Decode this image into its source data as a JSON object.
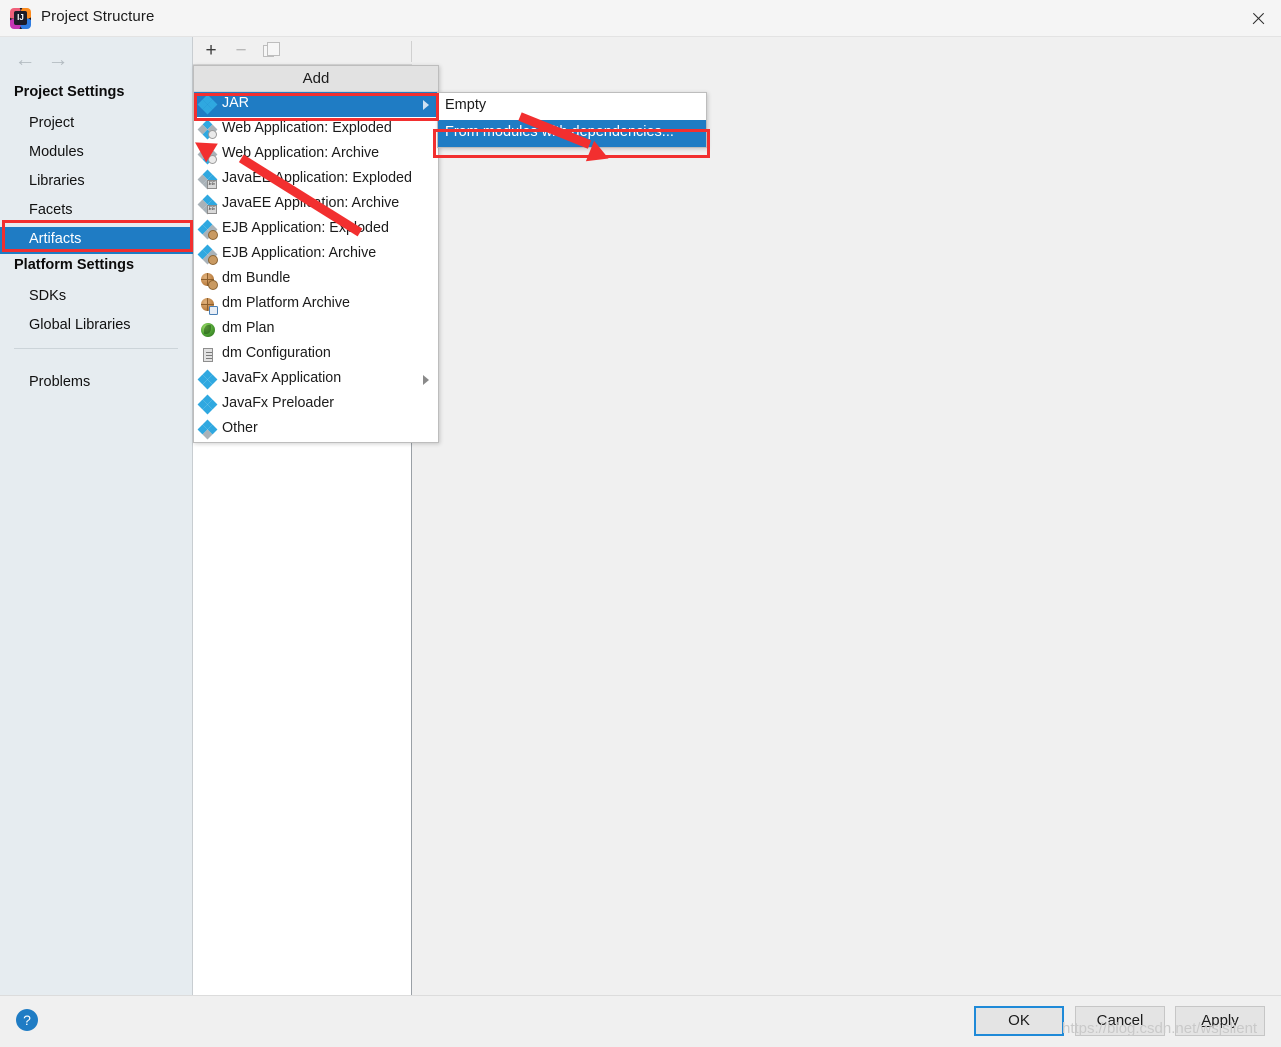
{
  "window": {
    "title": "Project Structure",
    "app_icon": "intellij-idea-icon",
    "icon_text": "IJ",
    "close_icon": "close-icon"
  },
  "nav": {
    "back_icon": "←",
    "forward_icon": "→"
  },
  "sidebar": {
    "sections": [
      {
        "heading": "Project Settings",
        "items": [
          {
            "label": "Project",
            "selected": false
          },
          {
            "label": "Modules",
            "selected": false
          },
          {
            "label": "Libraries",
            "selected": false
          },
          {
            "label": "Facets",
            "selected": false
          },
          {
            "label": "Artifacts",
            "selected": true
          }
        ]
      },
      {
        "heading": "Platform Settings",
        "items": [
          {
            "label": "SDKs",
            "selected": false
          },
          {
            "label": "Global Libraries",
            "selected": false
          }
        ]
      }
    ],
    "problems": {
      "label": "Problems",
      "selected": false
    }
  },
  "toolbar": {
    "add_icon": "+",
    "remove_icon": "−",
    "copy_icon": "copy-icon"
  },
  "add_menu": {
    "header": "Add",
    "items": [
      {
        "label": "JAR",
        "icon": "jar-icon",
        "selected": true,
        "submenu": true
      },
      {
        "label": "Web Application: Exploded",
        "icon": "web-exploded-icon",
        "selected": false,
        "submenu": false
      },
      {
        "label": "Web Application: Archive",
        "icon": "web-archive-icon",
        "selected": false,
        "submenu": false
      },
      {
        "label": "JavaEE Application: Exploded",
        "icon": "javaee-exploded-icon",
        "selected": false,
        "submenu": false
      },
      {
        "label": "JavaEE Application: Archive",
        "icon": "javaee-archive-icon",
        "selected": false,
        "submenu": false
      },
      {
        "label": "EJB Application: Exploded",
        "icon": "ejb-exploded-icon",
        "selected": false,
        "submenu": false
      },
      {
        "label": "EJB Application: Archive",
        "icon": "ejb-archive-icon",
        "selected": false,
        "submenu": false
      },
      {
        "label": "dm Bundle",
        "icon": "dm-bundle-icon",
        "selected": false,
        "submenu": false
      },
      {
        "label": "dm Platform Archive",
        "icon": "dm-platform-archive-icon",
        "selected": false,
        "submenu": false
      },
      {
        "label": "dm Plan",
        "icon": "dm-plan-icon",
        "selected": false,
        "submenu": false
      },
      {
        "label": "dm Configuration",
        "icon": "dm-configuration-icon",
        "selected": false,
        "submenu": false
      },
      {
        "label": "JavaFx Application",
        "icon": "javafx-application-icon",
        "selected": false,
        "submenu": true
      },
      {
        "label": "JavaFx Preloader",
        "icon": "javafx-preloader-icon",
        "selected": false,
        "submenu": false
      },
      {
        "label": "Other",
        "icon": "other-icon",
        "selected": false,
        "submenu": false
      }
    ]
  },
  "submenu": {
    "items": [
      {
        "label": "Empty",
        "selected": false
      },
      {
        "label": "From modules with dependencies...",
        "selected": true
      }
    ]
  },
  "footer": {
    "help_label": "?",
    "ok_label": "OK",
    "cancel_label": "Cancel",
    "apply_label_a": "A",
    "apply_label_rest": "pply",
    "watermark": "https://blog.csdn.net/wsjslient"
  },
  "annotations": {
    "color": "#f22f2f",
    "boxes": [
      {
        "name": "artifacts-highlight"
      },
      {
        "name": "jar-highlight"
      },
      {
        "name": "from-modules-highlight"
      }
    ],
    "arrows": [
      {
        "name": "arrow-to-jar"
      },
      {
        "name": "arrow-to-from-modules"
      }
    ]
  },
  "colors": {
    "selection_blue": "#1f7cc4",
    "annotation_red": "#f22f2f",
    "sidebar_bg": "#e6ecf0",
    "dialog_bg": "#f0f0f0"
  }
}
